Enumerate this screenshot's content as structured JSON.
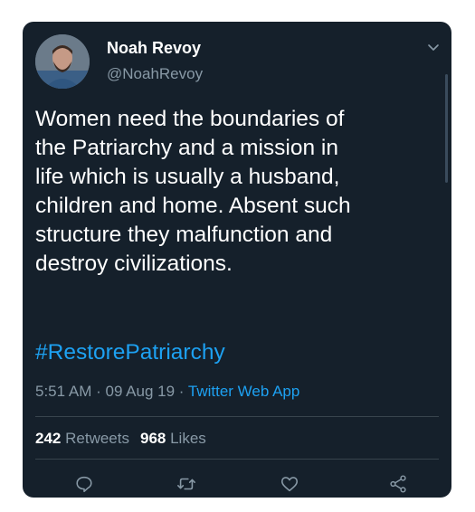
{
  "tweet": {
    "author": {
      "name": "Noah Revoy",
      "handle": "@NoahRevoy"
    },
    "text": "Women need the boundaries of\nthe Patriarchy and a mission in\nlife which is usually a husband,\nchildren and home. Absent such\nstructure they malfunction and\ndestroy civilizations.",
    "hashtag": "#RestorePatriarchy",
    "meta": {
      "time": "5:51 AM",
      "separator1": " · ",
      "date": "09 Aug 19",
      "separator2": " · ",
      "source": "Twitter Web App"
    },
    "stats": {
      "retweets_count": "242",
      "retweets_label": "Retweets",
      "likes_count": "968",
      "likes_label": "Likes"
    }
  },
  "icons": {
    "more": "chevron-down-icon",
    "reply": "reply-icon",
    "retweet": "retweet-icon",
    "like": "heart-icon",
    "share": "share-icon"
  },
  "colors": {
    "background": "#15202b",
    "text": "#ffffff",
    "muted": "#8899a6",
    "accent": "#1da1f2",
    "divider": "#38444d"
  }
}
